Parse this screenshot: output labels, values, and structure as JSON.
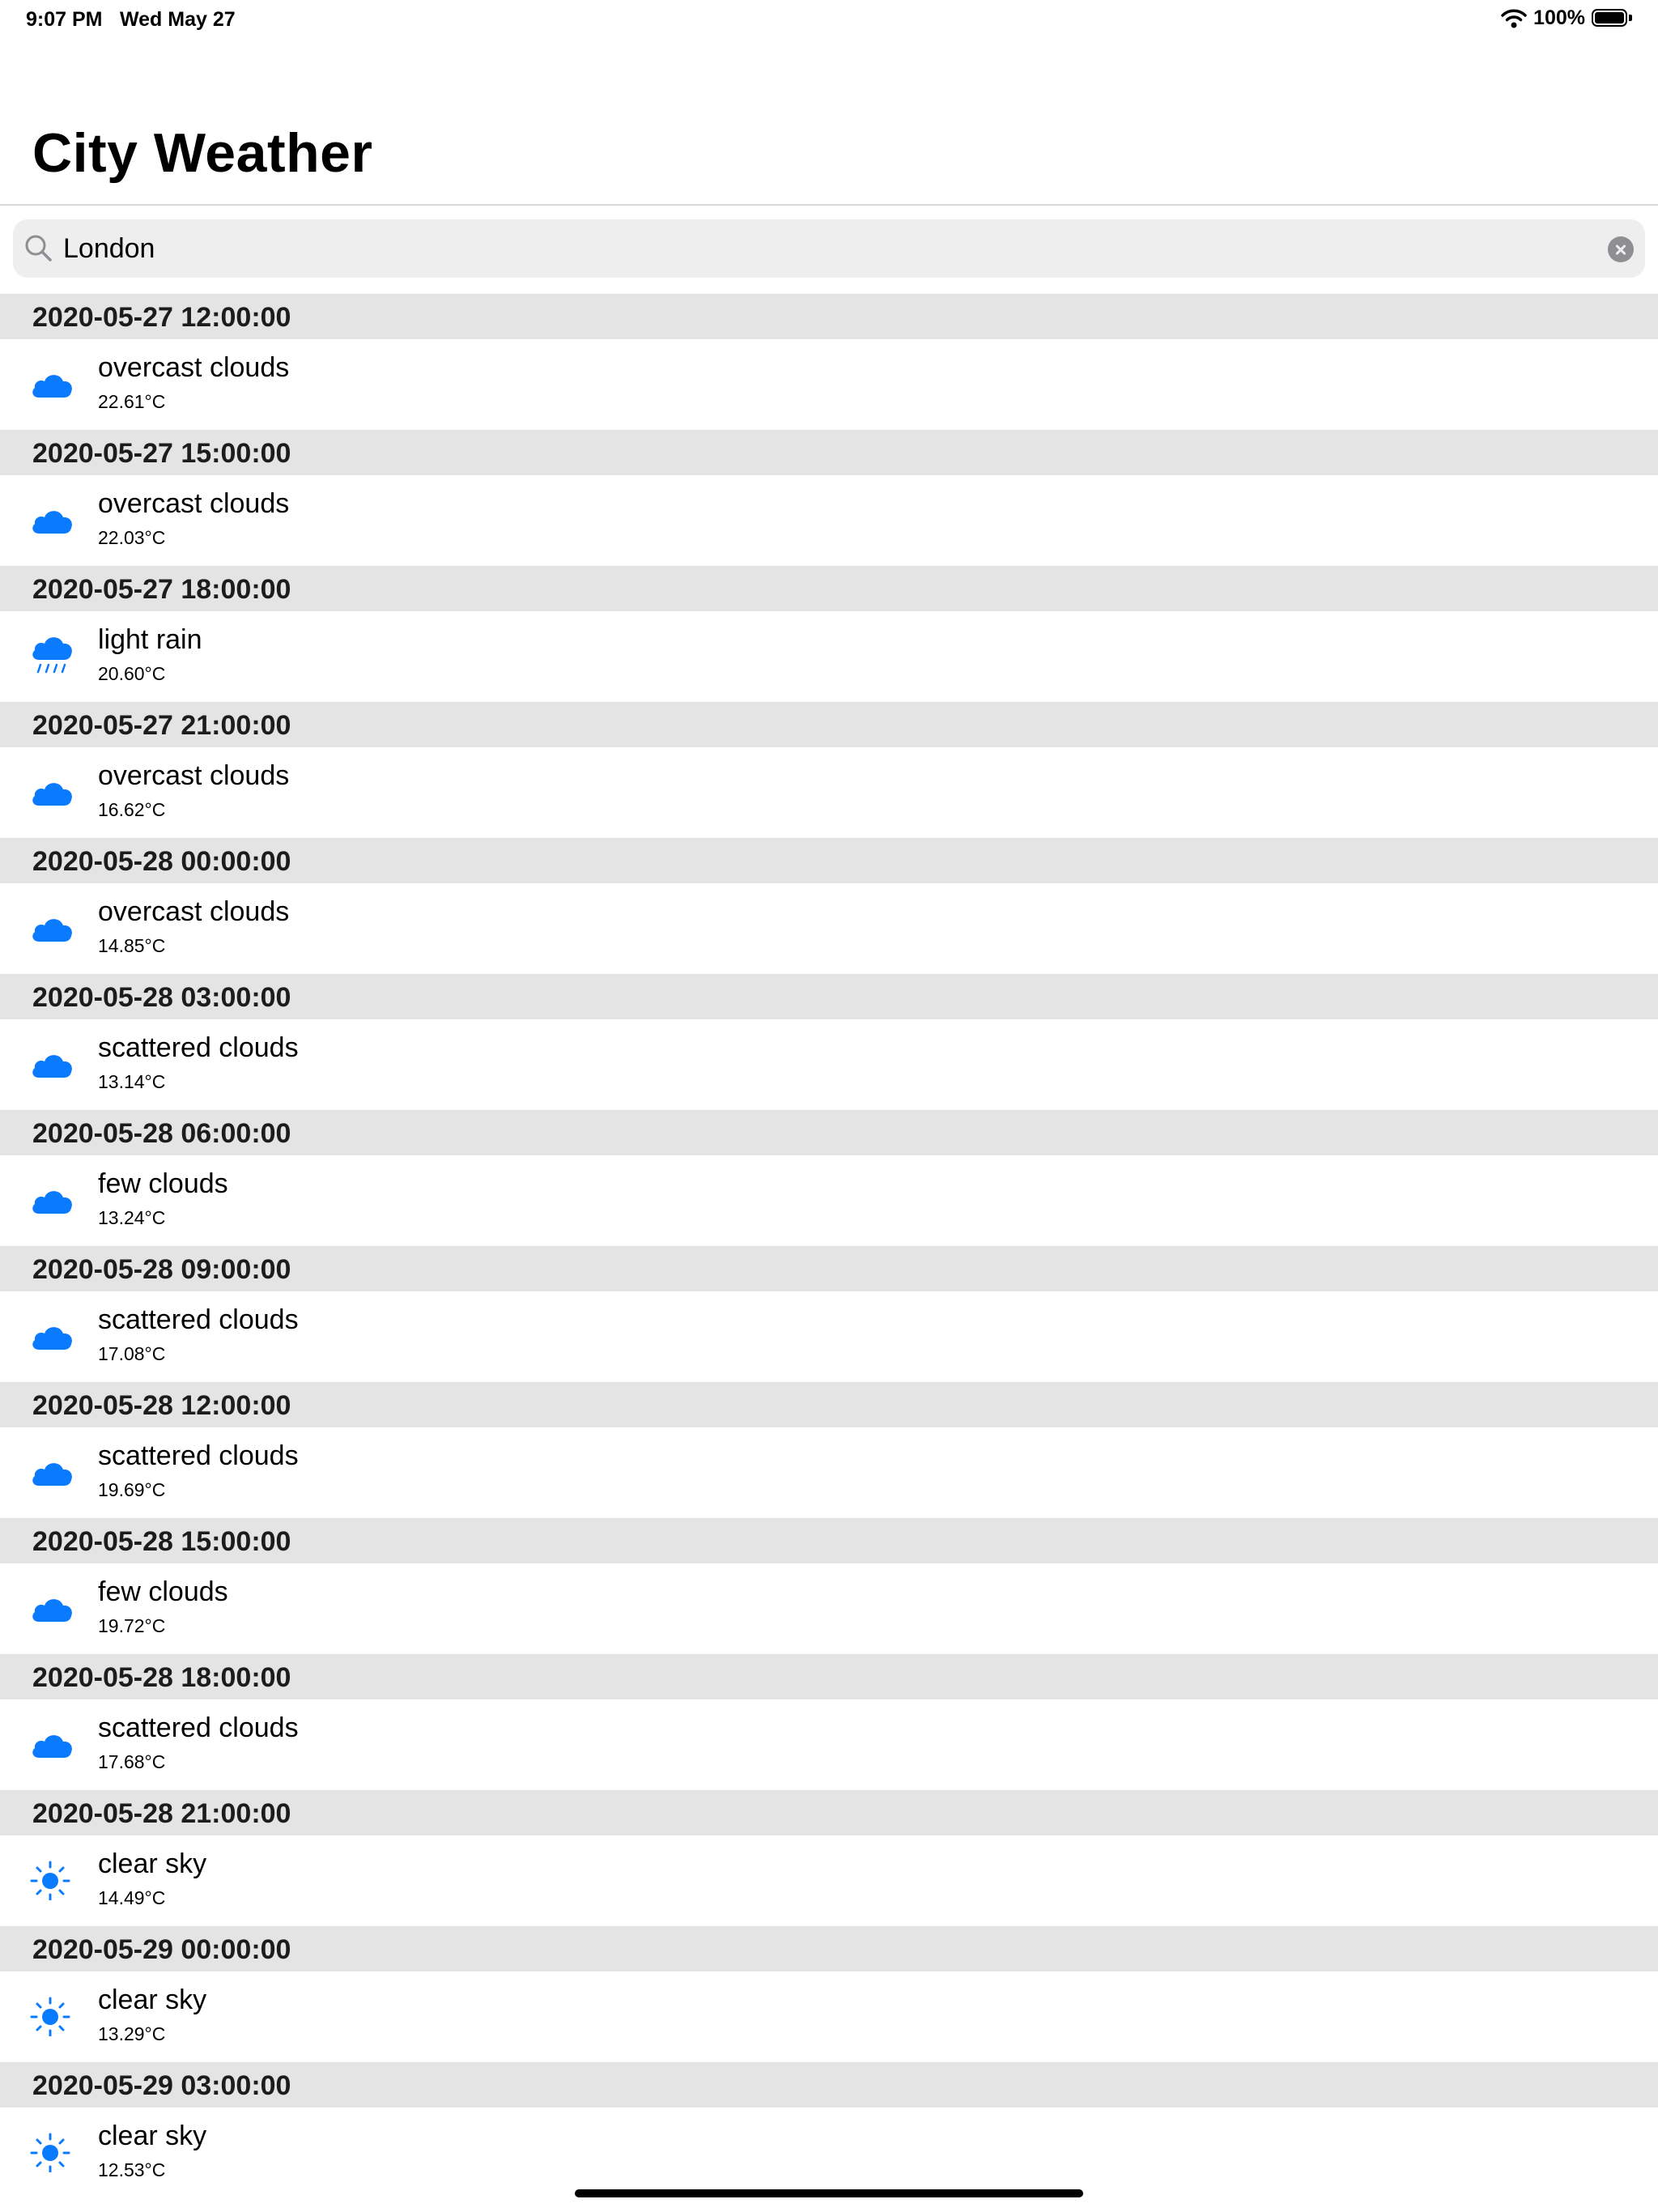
{
  "status_bar": {
    "time": "9:07 PM",
    "date": "Wed May 27",
    "battery_percent": "100%",
    "battery_level": 1.0
  },
  "nav": {
    "title": "City Weather"
  },
  "search": {
    "value": "London",
    "placeholder": ""
  },
  "colors": {
    "accent": "#0a7aff",
    "section_bg": "#e4e4e5",
    "search_bg": "#eeeeef"
  },
  "forecast": [
    {
      "time": "2020-05-27 12:00:00",
      "description": "overcast clouds",
      "temp": "22.61°C",
      "icon": "cloud-icon"
    },
    {
      "time": "2020-05-27 15:00:00",
      "description": "overcast clouds",
      "temp": "22.03°C",
      "icon": "cloud-icon"
    },
    {
      "time": "2020-05-27 18:00:00",
      "description": "light rain",
      "temp": "20.60°C",
      "icon": "rain-cloud-icon"
    },
    {
      "time": "2020-05-27 21:00:00",
      "description": "overcast clouds",
      "temp": "16.62°C",
      "icon": "cloud-icon"
    },
    {
      "time": "2020-05-28 00:00:00",
      "description": "overcast clouds",
      "temp": "14.85°C",
      "icon": "cloud-icon"
    },
    {
      "time": "2020-05-28 03:00:00",
      "description": "scattered clouds",
      "temp": "13.14°C",
      "icon": "cloud-icon"
    },
    {
      "time": "2020-05-28 06:00:00",
      "description": "few clouds",
      "temp": "13.24°C",
      "icon": "cloud-icon"
    },
    {
      "time": "2020-05-28 09:00:00",
      "description": "scattered clouds",
      "temp": "17.08°C",
      "icon": "cloud-icon"
    },
    {
      "time": "2020-05-28 12:00:00",
      "description": "scattered clouds",
      "temp": "19.69°C",
      "icon": "cloud-icon"
    },
    {
      "time": "2020-05-28 15:00:00",
      "description": "few clouds",
      "temp": "19.72°C",
      "icon": "cloud-icon"
    },
    {
      "time": "2020-05-28 18:00:00",
      "description": "scattered clouds",
      "temp": "17.68°C",
      "icon": "cloud-icon"
    },
    {
      "time": "2020-05-28 21:00:00",
      "description": "clear sky",
      "temp": "14.49°C",
      "icon": "sun-icon"
    },
    {
      "time": "2020-05-29 00:00:00",
      "description": "clear sky",
      "temp": "13.29°C",
      "icon": "sun-icon"
    },
    {
      "time": "2020-05-29 03:00:00",
      "description": "clear sky",
      "temp": "12.53°C",
      "icon": "sun-icon"
    }
  ]
}
